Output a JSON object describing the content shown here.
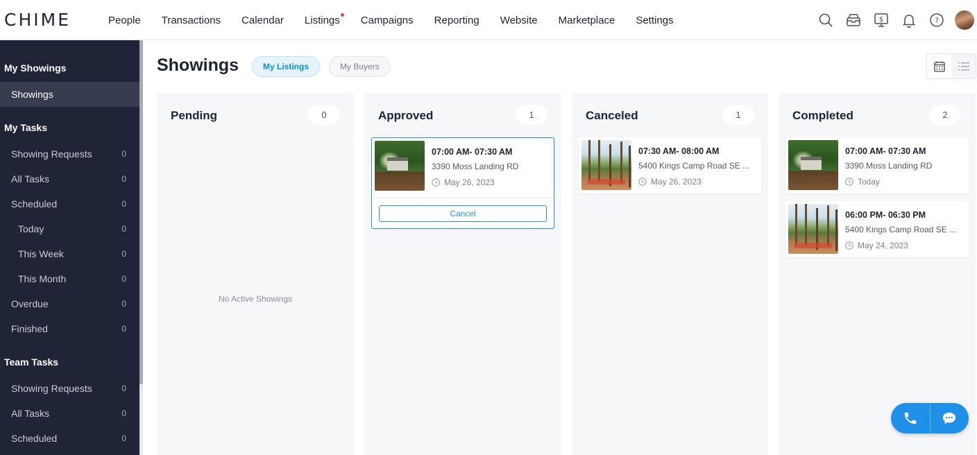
{
  "app": {
    "logo": "CHIME"
  },
  "nav": {
    "items": [
      "People",
      "Transactions",
      "Calendar",
      "Listings",
      "Campaigns",
      "Reporting",
      "Website",
      "Marketplace",
      "Settings"
    ],
    "notification_dot_item": "Listings"
  },
  "top_icons": [
    "search-icon",
    "inbox-icon",
    "dollar-monitor-icon",
    "bell-icon",
    "help-icon",
    "user-avatar"
  ],
  "sidebar": {
    "my_showings": {
      "title": "My Showings",
      "items": [
        {
          "label": "Showings",
          "active": true
        }
      ]
    },
    "my_tasks": {
      "title": "My Tasks",
      "items": [
        {
          "label": "Showing Requests",
          "count": "0"
        },
        {
          "label": "All Tasks",
          "count": "0"
        },
        {
          "label": "Scheduled",
          "count": "0"
        },
        {
          "label": "Today",
          "count": "0"
        },
        {
          "label": "This Week",
          "count": "0"
        },
        {
          "label": "This Month",
          "count": "0"
        },
        {
          "label": "Overdue",
          "count": "0"
        },
        {
          "label": "Finished",
          "count": "0"
        }
      ]
    },
    "team_tasks": {
      "title": "Team Tasks",
      "items": [
        {
          "label": "Showing Requests",
          "count": "0"
        },
        {
          "label": "All Tasks",
          "count": "0"
        },
        {
          "label": "Scheduled",
          "count": "0"
        }
      ]
    }
  },
  "main": {
    "title": "Showings",
    "filters": {
      "active": "My Listings",
      "inactive": "My Buyers"
    },
    "view_modes": [
      "calendar-view",
      "list-view"
    ],
    "columns": [
      {
        "title": "Pending",
        "count": "0",
        "empty_message": "No Active Showings",
        "cards": []
      },
      {
        "title": "Approved",
        "count": "1",
        "cards": [
          {
            "time": "07:00 AM- 07:30 AM",
            "address": "3390 Moss Landing RD",
            "date": "May 26, 2023",
            "photo": "house",
            "action": "Cancel"
          }
        ]
      },
      {
        "title": "Canceled",
        "count": "1",
        "cards": [
          {
            "time": "07:30 AM- 08:00 AM",
            "address": "5400 Kings Camp Road SE ...",
            "date": "May 26, 2023",
            "photo": "lake"
          }
        ]
      },
      {
        "title": "Completed",
        "count": "2",
        "cards": [
          {
            "time": "07:00 AM- 07:30 AM",
            "address": "3390 Moss Landing RD",
            "date": "Today",
            "photo": "house"
          },
          {
            "time": "06:00 PM- 06:30 PM",
            "address": "5400 Kings Camp Road SE ...",
            "date": "May 24, 2023",
            "photo": "lake"
          }
        ]
      }
    ]
  },
  "floating_actions": [
    "phone-icon",
    "chat-icon"
  ],
  "colors": {
    "sidebar_bg": "#202437",
    "accent": "#1e90e8",
    "column_bg": "#f6f7f9"
  }
}
